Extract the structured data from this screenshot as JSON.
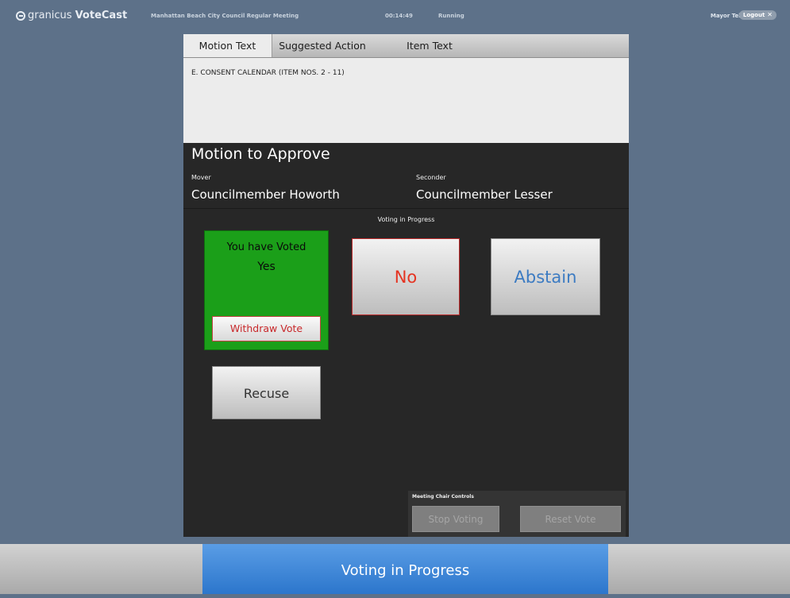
{
  "header": {
    "brand": "granicus",
    "product": "VoteCast",
    "meeting_title": "Manhattan Beach City Council Regular Meeting",
    "timer": "00:14:49",
    "status": "Running",
    "user": "Mayor Tell",
    "logout_label": "Logout",
    "logout_icon": "close-icon"
  },
  "tabs": [
    {
      "label": "Motion Text",
      "active": true
    },
    {
      "label": "Suggested Action",
      "active": false
    },
    {
      "label": "Item Text",
      "active": false
    }
  ],
  "motion_text": "E. CONSENT CALENDAR (ITEM NOS. 2 - 11)",
  "motion": {
    "title": "Motion to Approve",
    "mover_label": "Mover",
    "mover": "Councilmember Howorth",
    "seconder_label": "Seconder",
    "seconder": "Councilmember Lesser"
  },
  "voting": {
    "status_label": "Voting in Progress",
    "voted_title": "You have Voted",
    "voted_value": "Yes",
    "withdraw_label": "Withdraw Vote",
    "no_label": "No",
    "abstain_label": "Abstain",
    "recuse_label": "Recuse"
  },
  "chair_controls": {
    "label": "Meeting Chair Controls",
    "stop_label": "Stop Voting",
    "reset_label": "Reset Vote"
  },
  "footer": {
    "status": "Voting in Progress"
  },
  "colors": {
    "background": "#5d7189",
    "panel": "#272727",
    "voted_green": "#1b9f19",
    "no_red": "#e53422",
    "abstain_blue": "#3c7bc2",
    "footer_blue": "#2c76cc"
  }
}
